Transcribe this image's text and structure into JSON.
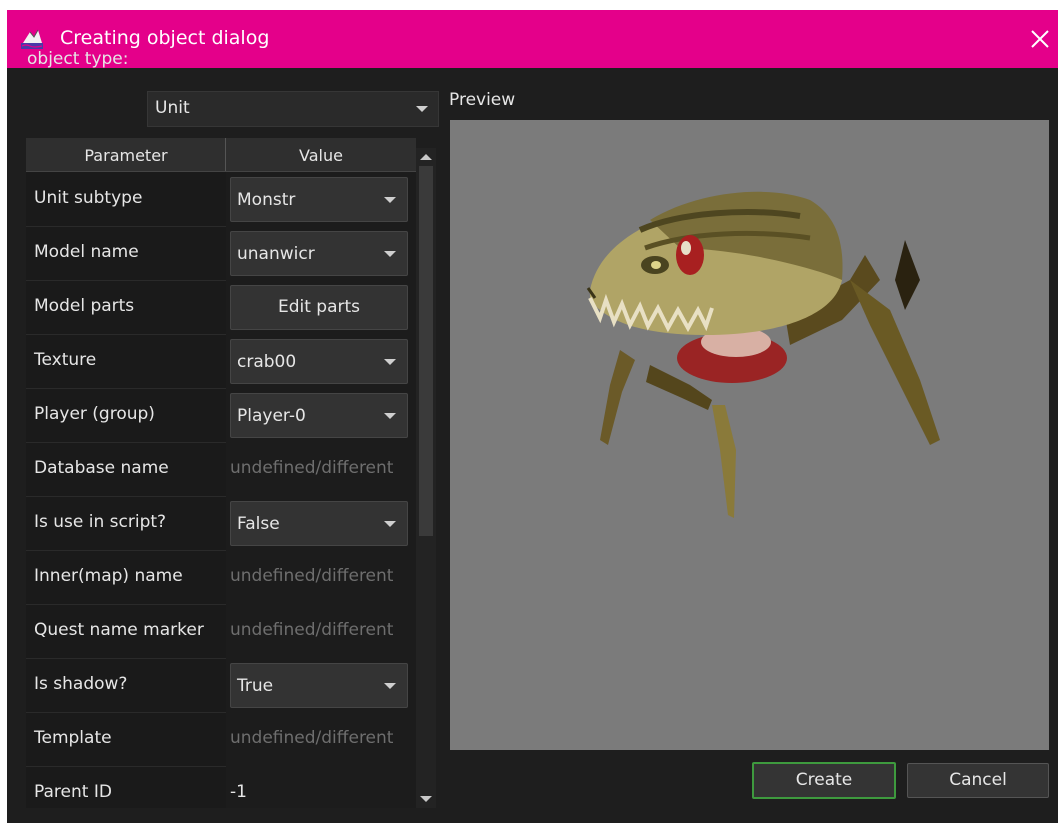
{
  "window": {
    "title": "Creating object dialog",
    "accent": "#e4008a"
  },
  "object_type": {
    "label": "object type:",
    "value": "Unit"
  },
  "table": {
    "headers": [
      "Parameter",
      "Value"
    ],
    "rows": [
      {
        "name": "Unit subtype",
        "kind": "combo",
        "value": "Monstr"
      },
      {
        "name": "Model name",
        "kind": "combo",
        "value": "unanwicr"
      },
      {
        "name": "Model parts",
        "kind": "button",
        "value": "Edit parts"
      },
      {
        "name": "Texture",
        "kind": "combo",
        "value": "crab00"
      },
      {
        "name": "Player (group)",
        "kind": "combo",
        "value": "Player-0"
      },
      {
        "name": "Database name",
        "kind": "text",
        "value": "undefined/different"
      },
      {
        "name": "Is use in script?",
        "kind": "combo",
        "value": "False"
      },
      {
        "name": "Inner(map) name",
        "kind": "text",
        "value": "undefined/different"
      },
      {
        "name": "Quest name marker",
        "kind": "text",
        "value": "undefined/different"
      },
      {
        "name": "Is shadow?",
        "kind": "combo",
        "value": "True"
      },
      {
        "name": "Template",
        "kind": "text",
        "value": "undefined/different"
      },
      {
        "name": "Parent ID",
        "kind": "text",
        "value": "-1"
      }
    ]
  },
  "preview": {
    "label": "Preview",
    "background": "#7b7b7b"
  },
  "buttons": {
    "create": "Create",
    "cancel": "Cancel"
  }
}
